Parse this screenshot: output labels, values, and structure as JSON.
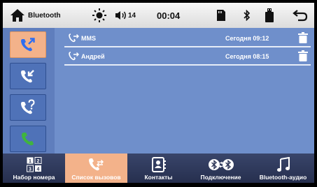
{
  "status_bar": {
    "app_label": "Bluetooth",
    "volume_level": "14",
    "clock": "00:04"
  },
  "calls": [
    {
      "name": "MMS",
      "time": "Сегодня 09:12"
    },
    {
      "name": "Андрей",
      "time": "Сегодня 08:15"
    }
  ],
  "tabs": [
    {
      "label": "Набор номера",
      "icon": "dialpad-icon"
    },
    {
      "label": "Список вызовов",
      "icon": "call-log-icon"
    },
    {
      "label": "Контакты",
      "icon": "contacts-icon"
    },
    {
      "label": "Подключение",
      "icon": "bluetooth-connect-icon"
    },
    {
      "label": "Bluetooth-аудио",
      "icon": "music-note-icon"
    }
  ],
  "dialpad_digits": [
    "1",
    "2",
    "3",
    "4"
  ],
  "colors": {
    "accent": "#f3b28a",
    "panel": "#6f8fcb",
    "sidebar_button": "#4f72b8",
    "answered_icon": "#3fb43f"
  }
}
